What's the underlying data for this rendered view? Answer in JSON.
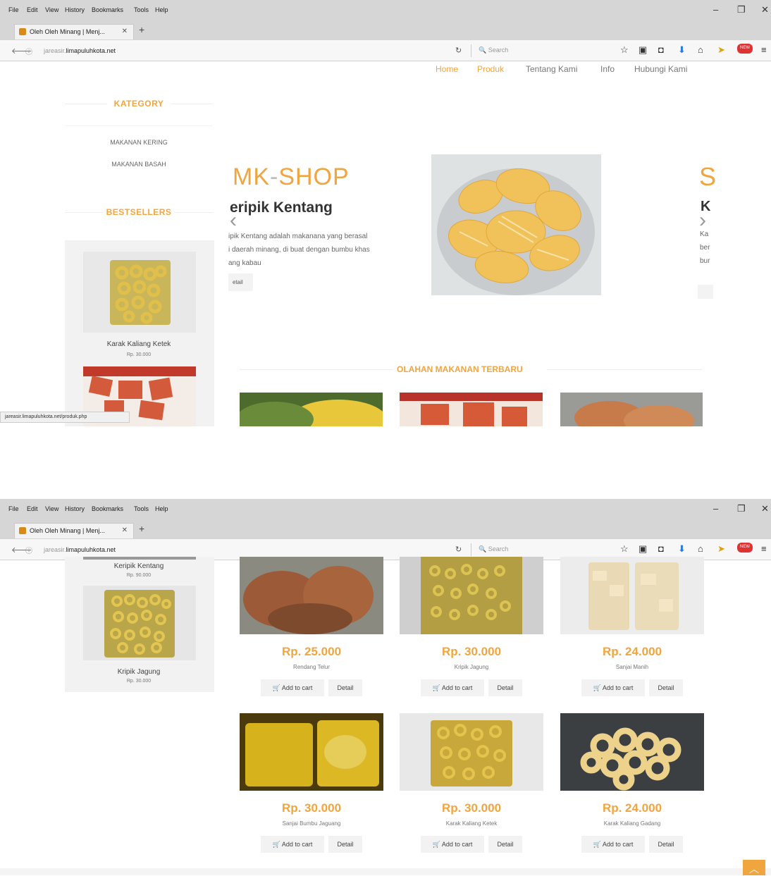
{
  "browser": {
    "menu": [
      "File",
      "Edit",
      "View",
      "History",
      "Bookmarks",
      "Tools",
      "Help"
    ],
    "tab_title": "Oleh Oleh Minang | Menj...",
    "url_prefix": "jareasir.",
    "url_domain": "limapuluhkota.net",
    "search_placeholder": "Search",
    "status_url": "jareasir.limapuluhkota.net/produk.php",
    "new_badge": "NEW"
  },
  "nav": {
    "items": [
      "Home",
      "Produk",
      "Tentang Kami",
      "Info",
      "Hubungi Kami"
    ]
  },
  "sidebar": {
    "category_title": "KATEGORY",
    "categories": [
      "MAKANAN KERING",
      "MAKANAN BASAH"
    ],
    "bestsellers_title": "BESTSELLERS",
    "bestsellers": [
      {
        "name": "Karak Kaliang Ketek",
        "price": "Rp. 30.000"
      },
      {
        "name": "Keripik Kentang",
        "price": "Rp. 90.000"
      },
      {
        "name": "Kripik Jagung",
        "price": "Rp. 30.000"
      }
    ]
  },
  "carousel": {
    "brand_left": "MK",
    "brand_dash": "-",
    "brand_right": "SHOP",
    "product_name": "eripik Kentang",
    "desc_lines": [
      "ipik Kentang adalah makanana yang berasal",
      "i daerah minang, di buat dengan bumbu khas",
      "ang kabau"
    ],
    "button": "etail",
    "right_letter": "S",
    "right_name": "K",
    "right_lines": [
      "Ka",
      "ber",
      "bur"
    ]
  },
  "newest": {
    "title": "OLAHAN MAKANAN TERBARU",
    "add_label": "Add to cart",
    "detail_label": "Detail",
    "products": [
      {
        "name": "Rendang Telur",
        "price": "Rp. 25.000"
      },
      {
        "name": "Kripik Jagung",
        "price": "Rp. 30.000"
      },
      {
        "name": "Sanjai Manih",
        "price": "Rp. 24.000"
      },
      {
        "name": "Sanjai Bumbu Jaguang",
        "price": "Rp. 30.000"
      },
      {
        "name": "Karak Kaliang Ketek",
        "price": "Rp. 30.000"
      },
      {
        "name": "Karak Kaliang Gadang",
        "price": "Rp. 24.000"
      }
    ]
  }
}
